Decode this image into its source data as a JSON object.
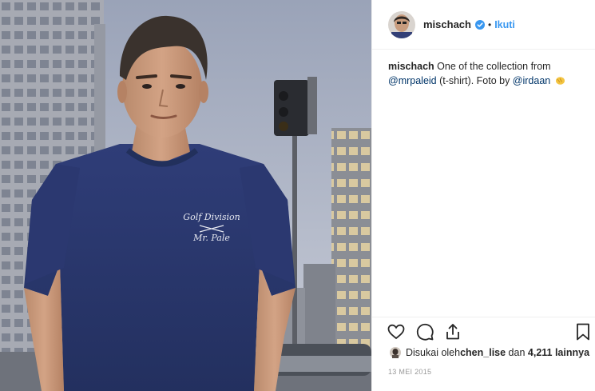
{
  "post": {
    "username": "mischach",
    "separator": "•",
    "follow_label": "Ikuti",
    "caption": {
      "username": "mischach",
      "text_1": " One of the collection from",
      "mention_1": "@mrpaleid",
      "text_2": " (t-shirt). Foto by ",
      "mention_2": "@irdaan",
      "emoji_icon": "clapping-hands-icon"
    },
    "shirt_print": {
      "line_1": "Golf Division",
      "line_2": "Mr. Pale"
    },
    "likes": {
      "prefix": "Disukai oleh ",
      "first_liker": "chen_lise",
      "middle": " dan ",
      "count": "4,211 lainnya"
    },
    "date": "13 MEI 2015",
    "icons": {
      "like": "heart-icon",
      "comment": "comment-icon",
      "share": "share-icon",
      "save": "bookmark-icon",
      "verified": "verified-badge-icon"
    },
    "colors": {
      "accent": "#3897f0",
      "mention": "#003569",
      "text": "#262626",
      "muted": "#999999"
    }
  }
}
